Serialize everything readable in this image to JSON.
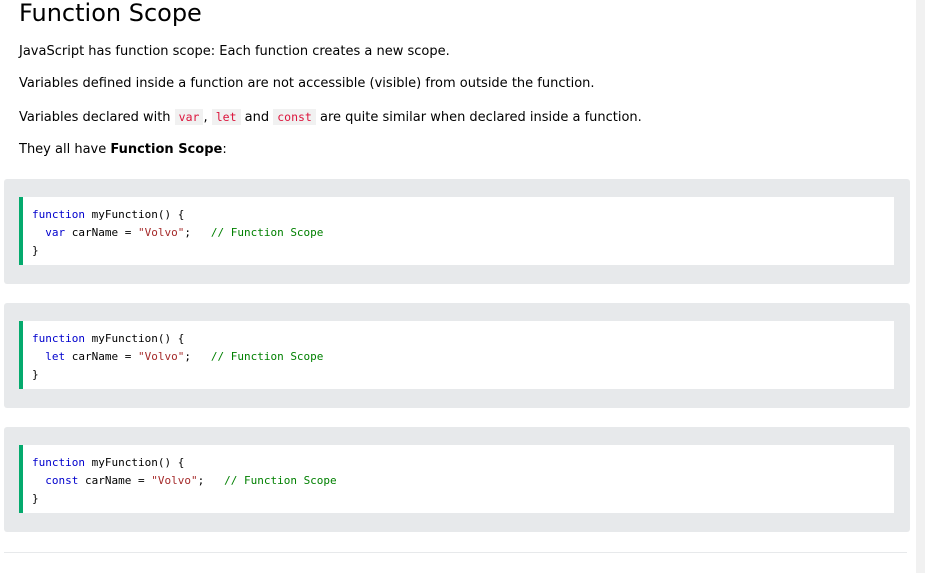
{
  "page": {
    "title": "Function Scope",
    "paragraphs": {
      "p1": "JavaScript has function scope: Each function creates a new scope.",
      "p2": "Variables defined inside a function are not accessible (visible) from outside the function.",
      "p3_a": "Variables declared with ",
      "p3_code1": "var",
      "p3_b": ", ",
      "p3_code2": "let",
      "p3_c": " and ",
      "p3_code3": "const",
      "p3_d": " are quite similar when declared inside a function.",
      "p4_a": "They all have ",
      "p4_bold": "Function Scope",
      "p4_b": ":"
    }
  },
  "examples": [
    {
      "line1_kw": "function",
      "line1_rest": " myFunction() {",
      "line2_indent": "  ",
      "line2_kw": "var",
      "line2_mid": " carName = ",
      "line2_str": "\"Volvo\"",
      "line2_end": ";   ",
      "line2_cmt": "// Function Scope",
      "line3": "}"
    },
    {
      "line1_kw": "function",
      "line1_rest": " myFunction() {",
      "line2_indent": "  ",
      "line2_kw": "let",
      "line2_mid": " carName = ",
      "line2_str": "\"Volvo\"",
      "line2_end": ";   ",
      "line2_cmt": "// Function Scope",
      "line3": "}"
    },
    {
      "line1_kw": "function",
      "line1_rest": " myFunction() {",
      "line2_indent": "  ",
      "line2_kw": "const",
      "line2_mid": " carName = ",
      "line2_str": "\"Volvo\"",
      "line2_end": ";   ",
      "line2_cmt": "// Function Scope",
      "line3": "}"
    }
  ],
  "colors": {
    "accent_border": "#04aa6d",
    "example_bg": "#e7e9eb",
    "inline_code": "#dc143c",
    "keyword": "#0000cd",
    "string": "#a52a2a",
    "comment": "#008000"
  }
}
